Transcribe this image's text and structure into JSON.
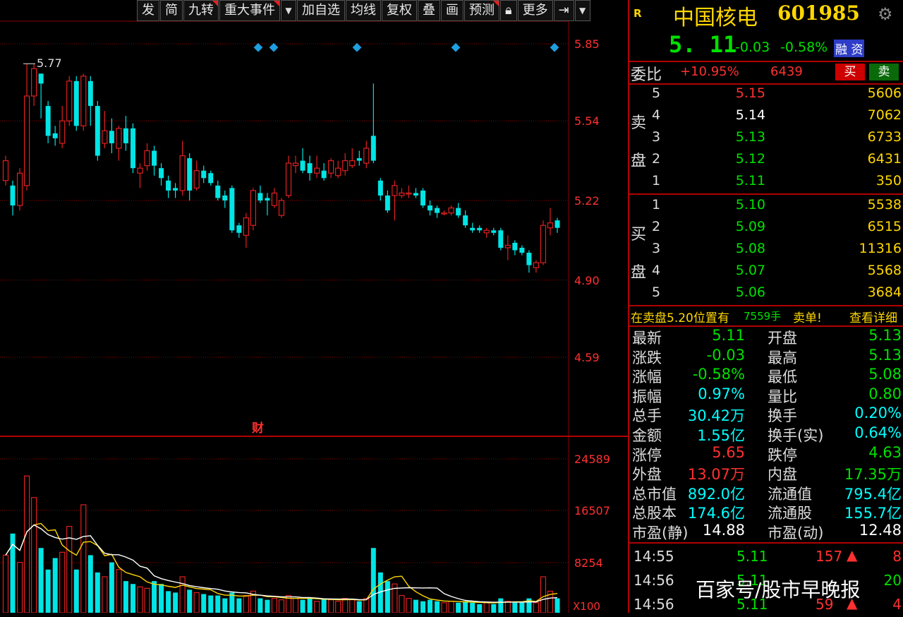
{
  "toolbar": {
    "buttons": [
      "发",
      "简",
      "九转",
      "重大事件",
      "加自选",
      "均线",
      "复权",
      "叠",
      "画",
      "预测",
      "锁",
      "更多"
    ],
    "lock_icon": "lock-icon",
    "exit_icon": "arrow-exit-icon",
    "dropdown_icon": "chevron-down-icon"
  },
  "chart": {
    "price_ticks": [
      "5.85",
      "5.54",
      "5.22",
      "4.90",
      "4.59"
    ],
    "volume_ticks": [
      "24589",
      "16507",
      "8254"
    ],
    "volume_unit": "X100",
    "high_marker": "5.77",
    "finance_mark": "财",
    "colors": {
      "up": "#e02020",
      "down": "#00e5e5",
      "grid": "#8b0000",
      "ma1": "#ffffff",
      "ma2": "#ffd700"
    }
  },
  "chart_data": {
    "type": "candlestick",
    "price_range": [
      4.45,
      5.9
    ],
    "candles": [
      [
        5.3,
        5.38,
        5.4,
        5.28
      ],
      [
        5.28,
        5.2,
        5.3,
        5.16
      ],
      [
        5.2,
        5.33,
        5.35,
        5.18
      ],
      [
        5.28,
        5.64,
        5.77,
        5.26
      ],
      [
        5.64,
        5.75,
        5.77,
        5.6
      ],
      [
        5.73,
        5.69,
        5.73,
        5.55
      ],
      [
        5.6,
        5.48,
        5.62,
        5.45
      ],
      [
        5.49,
        5.47,
        5.52,
        5.44
      ],
      [
        5.45,
        5.54,
        5.6,
        5.43
      ],
      [
        5.54,
        5.7,
        5.72,
        5.52
      ],
      [
        5.7,
        5.52,
        5.72,
        5.5
      ],
      [
        5.52,
        5.72,
        5.73,
        5.5
      ],
      [
        5.7,
        5.6,
        5.72,
        5.52
      ],
      [
        5.6,
        5.4,
        5.62,
        5.38
      ],
      [
        5.45,
        5.5,
        5.58,
        5.43
      ],
      [
        5.5,
        5.45,
        5.55,
        5.41
      ],
      [
        5.43,
        5.51,
        5.52,
        5.38
      ],
      [
        5.51,
        5.45,
        5.56,
        5.42
      ],
      [
        5.51,
        5.35,
        5.53,
        5.33
      ],
      [
        5.33,
        5.35,
        5.37,
        5.27
      ],
      [
        5.36,
        5.42,
        5.45,
        5.34
      ],
      [
        5.42,
        5.36,
        5.44,
        5.32
      ],
      [
        5.35,
        5.31,
        5.37,
        5.28
      ],
      [
        5.3,
        5.26,
        5.32,
        5.23
      ],
      [
        5.27,
        5.26,
        5.29,
        5.23
      ],
      [
        5.26,
        5.4,
        5.46,
        5.24
      ],
      [
        5.39,
        5.26,
        5.41,
        5.22
      ],
      [
        5.27,
        5.34,
        5.38,
        5.26
      ],
      [
        5.34,
        5.31,
        5.36,
        5.29
      ],
      [
        5.33,
        5.29,
        5.34,
        5.28
      ],
      [
        5.28,
        5.23,
        5.3,
        5.22
      ],
      [
        5.24,
        5.22,
        5.26,
        5.19
      ],
      [
        5.27,
        5.1,
        5.28,
        5.09
      ],
      [
        5.12,
        5.09,
        5.13,
        5.07
      ],
      [
        5.08,
        5.15,
        5.17,
        5.03
      ],
      [
        5.12,
        5.26,
        5.27,
        5.1
      ],
      [
        5.25,
        5.22,
        5.28,
        5.21
      ],
      [
        5.23,
        5.22,
        5.25,
        5.16
      ],
      [
        5.2,
        5.25,
        5.27,
        5.19
      ],
      [
        5.16,
        5.22,
        5.23,
        5.15
      ],
      [
        5.24,
        5.37,
        5.4,
        5.23
      ],
      [
        5.36,
        5.37,
        5.4,
        5.33
      ],
      [
        5.38,
        5.34,
        5.43,
        5.33
      ],
      [
        5.37,
        5.33,
        5.4,
        5.3
      ],
      [
        5.33,
        5.35,
        5.4,
        5.31
      ],
      [
        5.34,
        5.31,
        5.37,
        5.3
      ],
      [
        5.33,
        5.38,
        5.39,
        5.31
      ],
      [
        5.32,
        5.35,
        5.38,
        5.31
      ],
      [
        5.34,
        5.38,
        5.41,
        5.32
      ],
      [
        5.36,
        5.38,
        5.43,
        5.35
      ],
      [
        5.39,
        5.38,
        5.42,
        5.36
      ],
      [
        5.37,
        5.43,
        5.46,
        5.35
      ],
      [
        5.48,
        5.38,
        5.69,
        5.37
      ],
      [
        5.3,
        5.24,
        5.31,
        5.22
      ],
      [
        5.24,
        5.18,
        5.26,
        5.17
      ],
      [
        5.24,
        5.28,
        5.3,
        5.14
      ],
      [
        5.24,
        5.25,
        5.27,
        5.23
      ],
      [
        5.25,
        5.25,
        5.28,
        5.23
      ],
      [
        5.25,
        5.24,
        5.27,
        5.23
      ],
      [
        5.26,
        5.2,
        5.27,
        5.19
      ],
      [
        5.2,
        5.18,
        5.22,
        5.16
      ],
      [
        5.19,
        5.17,
        5.2,
        5.15
      ],
      [
        5.17,
        5.17,
        5.18,
        5.16
      ],
      [
        5.17,
        5.19,
        5.2,
        5.16
      ],
      [
        5.19,
        5.16,
        5.21,
        5.15
      ],
      [
        5.16,
        5.12,
        5.18,
        5.11
      ],
      [
        5.11,
        5.1,
        5.13,
        5.09
      ],
      [
        5.11,
        5.1,
        5.12,
        5.09
      ],
      [
        5.09,
        5.1,
        5.11,
        5.07
      ],
      [
        5.1,
        5.09,
        5.11,
        5.08
      ],
      [
        5.1,
        5.03,
        5.11,
        5.02
      ],
      [
        5.03,
        5.04,
        5.08,
        4.98
      ],
      [
        5.05,
        5.02,
        5.06,
        5.0
      ],
      [
        5.03,
        5.01,
        5.04,
        5.0
      ],
      [
        5.01,
        4.96,
        5.02,
        4.93
      ],
      [
        4.95,
        4.97,
        4.98,
        4.93
      ],
      [
        4.97,
        5.12,
        5.14,
        4.96
      ],
      [
        5.11,
        5.13,
        5.19,
        5.08
      ],
      [
        5.14,
        5.11,
        5.15,
        5.09
      ]
    ],
    "volumes": [
      0.4,
      0.55,
      0.35,
      0.95,
      0.8,
      0.45,
      0.3,
      0.38,
      0.42,
      0.6,
      0.3,
      0.75,
      0.4,
      0.28,
      0.25,
      0.35,
      0.3,
      0.22,
      0.2,
      0.18,
      0.17,
      0.22,
      0.2,
      0.15,
      0.14,
      0.25,
      0.16,
      0.14,
      0.13,
      0.12,
      0.12,
      0.1,
      0.14,
      0.1,
      0.12,
      0.15,
      0.1,
      0.09,
      0.1,
      0.09,
      0.12,
      0.1,
      0.09,
      0.1,
      0.08,
      0.1,
      0.09,
      0.08,
      0.1,
      0.09,
      0.08,
      0.1,
      0.45,
      0.28,
      0.22,
      0.2,
      0.12,
      0.1,
      0.09,
      0.08,
      0.09,
      0.08,
      0.07,
      0.08,
      0.07,
      0.08,
      0.07,
      0.06,
      0.07,
      0.06,
      0.1,
      0.08,
      0.07,
      0.07,
      0.1,
      0.07,
      0.25,
      0.15,
      0.1
    ]
  },
  "quote": {
    "badge": "R",
    "name": "中国核电",
    "code": "601985",
    "price": "5. 11",
    "change": "-0.03",
    "pct": "-0.58%",
    "tags": "融 资",
    "weibi_label": "委比",
    "weibi_value": "+10.95%",
    "weicha": "6439",
    "buy_label": "买",
    "sell_label": "卖",
    "sell_side_label_1": "卖",
    "sell_side_label_2": "盘",
    "buy_side_label_1": "买",
    "buy_side_label_2": "盘",
    "asks": [
      {
        "lvl": "5",
        "px": "5.15",
        "vol": "5606",
        "c": "red"
      },
      {
        "lvl": "4",
        "px": "5.14",
        "vol": "7062",
        "c": "white"
      },
      {
        "lvl": "3",
        "px": "5.13",
        "vol": "6733",
        "c": "green"
      },
      {
        "lvl": "2",
        "px": "5.12",
        "vol": "6431",
        "c": "green"
      },
      {
        "lvl": "1",
        "px": "5.11",
        "vol": "350",
        "c": "green"
      }
    ],
    "bids": [
      {
        "lvl": "1",
        "px": "5.10",
        "vol": "5538",
        "c": "green"
      },
      {
        "lvl": "2",
        "px": "5.09",
        "vol": "6515",
        "c": "green"
      },
      {
        "lvl": "3",
        "px": "5.08",
        "vol": "11316",
        "c": "green"
      },
      {
        "lvl": "4",
        "px": "5.07",
        "vol": "5568",
        "c": "green"
      },
      {
        "lvl": "5",
        "px": "5.06",
        "vol": "3684",
        "c": "green"
      }
    ],
    "notice_a": "在卖盘5.20位置有",
    "notice_b": "7559手",
    "notice_c": "卖单!",
    "notice_link": "查看详细",
    "stats": [
      {
        "l1": "最新",
        "v1": "5.11",
        "c1": "green",
        "l2": "开盘",
        "v2": "5.13",
        "c2": "green"
      },
      {
        "l1": "涨跌",
        "v1": "-0.03",
        "c1": "green",
        "l2": "最高",
        "v2": "5.13",
        "c2": "green"
      },
      {
        "l1": "涨幅",
        "v1": "-0.58%",
        "c1": "green",
        "l2": "最低",
        "v2": "5.08",
        "c2": "green"
      },
      {
        "l1": "振幅",
        "v1": "0.97%",
        "c1": "cyan",
        "l2": "量比",
        "v2": "0.80",
        "c2": "green"
      },
      {
        "l1": "总手",
        "v1": "30.42万",
        "c1": "cyan",
        "l2": "换手",
        "v2": "0.20%",
        "c2": "cyan"
      },
      {
        "l1": "金额",
        "v1": "1.55亿",
        "c1": "cyan",
        "l2": "换手(实)",
        "v2": "0.64%",
        "c2": "cyan"
      },
      {
        "l1": "涨停",
        "v1": "5.65",
        "c1": "red",
        "l2": "跌停",
        "v2": "4.63",
        "c2": "green"
      },
      {
        "l1": "外盘",
        "v1": "13.07万",
        "c1": "red",
        "l2": "内盘",
        "v2": "17.35万",
        "c2": "green"
      },
      {
        "l1": "总市值",
        "v1": "892.0亿",
        "c1": "cyan",
        "l2": "流通值",
        "v2": "795.4亿",
        "c2": "cyan"
      },
      {
        "l1": "总股本",
        "v1": "174.6亿",
        "c1": "cyan",
        "l2": "流通股",
        "v2": "155.7亿",
        "c2": "cyan"
      },
      {
        "l1": "市盈(静)",
        "v1": "14.88",
        "c1": "white",
        "l2": "市盈(动)",
        "v2": "12.48",
        "c2": "white"
      }
    ],
    "ticks": [
      {
        "t": "14:55",
        "p": "5.11",
        "vol": "157",
        "arrow": "▲",
        "n": "8",
        "c": "red"
      },
      {
        "t": "14:56",
        "p": "5.11",
        "vol": "",
        "arrow": "",
        "n": "20",
        "c": "green"
      },
      {
        "t": "14:56",
        "p": "5.11",
        "vol": "59",
        "arrow": "▲",
        "n": "4",
        "c": "red"
      }
    ]
  },
  "watermark": "百家号/股市早晚报"
}
